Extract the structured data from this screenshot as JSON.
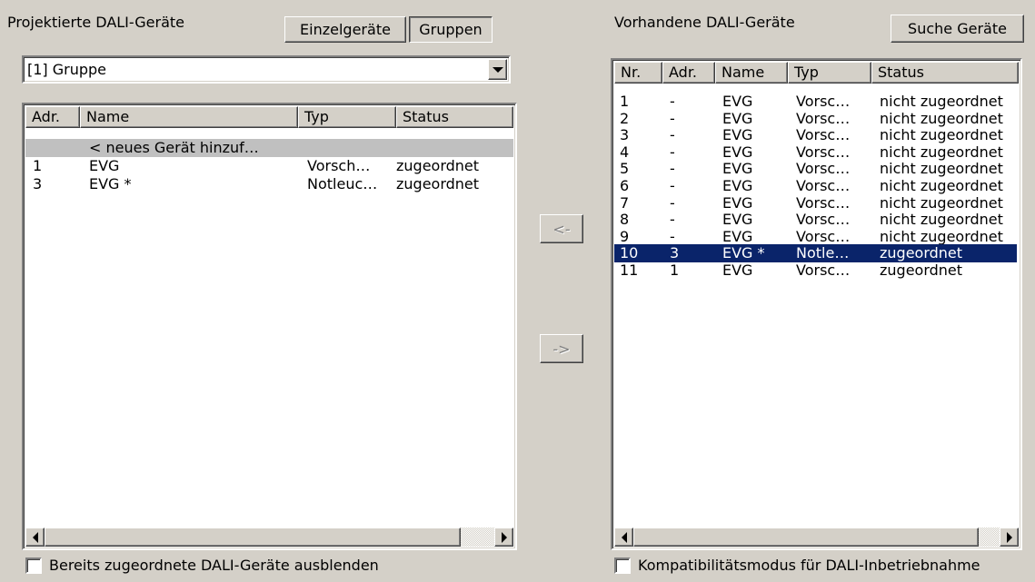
{
  "left": {
    "title": "Projektierte DALI-Geräte",
    "btn_single": "Einzelgeräte",
    "btn_groups": "Gruppen",
    "combo_value": "[1] Gruppe",
    "columns": [
      "Adr.",
      "Name",
      "Typ",
      "Status"
    ],
    "new_row": "< neues Gerät hinzuf…",
    "rows": [
      {
        "adr": "1",
        "name": "EVG",
        "typ": "Vorsch…",
        "status": "zugeordnet"
      },
      {
        "adr": "3",
        "name": "EVG *",
        "typ": "Notleuc…",
        "status": "zugeordnet"
      }
    ],
    "checkbox_label": "Bereits zugeordnete DALI-Geräte ausblenden"
  },
  "middle": {
    "assign_left": "<-",
    "assign_right": "->"
  },
  "right": {
    "title": "Vorhandene DALI-Geräte",
    "btn_search": "Suche Geräte",
    "columns": [
      "Nr.",
      "Adr.",
      "Name",
      "Typ",
      "Status"
    ],
    "rows": [
      {
        "nr": "1",
        "adr": "-",
        "name": "EVG",
        "typ": "Vorsc…",
        "status": "nicht zugeordnet"
      },
      {
        "nr": "2",
        "adr": "-",
        "name": "EVG",
        "typ": "Vorsc…",
        "status": "nicht zugeordnet"
      },
      {
        "nr": "3",
        "adr": "-",
        "name": "EVG",
        "typ": "Vorsc…",
        "status": "nicht zugeordnet"
      },
      {
        "nr": "4",
        "adr": "-",
        "name": "EVG",
        "typ": "Vorsc…",
        "status": "nicht zugeordnet"
      },
      {
        "nr": "5",
        "adr": "-",
        "name": "EVG",
        "typ": "Vorsc…",
        "status": "nicht zugeordnet"
      },
      {
        "nr": "6",
        "adr": "-",
        "name": "EVG",
        "typ": "Vorsc…",
        "status": "nicht zugeordnet"
      },
      {
        "nr": "7",
        "adr": "-",
        "name": "EVG",
        "typ": "Vorsc…",
        "status": "nicht zugeordnet"
      },
      {
        "nr": "8",
        "adr": "-",
        "name": "EVG",
        "typ": "Vorsc…",
        "status": "nicht zugeordnet"
      },
      {
        "nr": "9",
        "adr": "-",
        "name": "EVG",
        "typ": "Vorsc…",
        "status": "nicht zugeordnet"
      },
      {
        "nr": "10",
        "adr": "3",
        "name": "EVG *",
        "typ": "Notle…",
        "status": "zugeordnet",
        "selected": true
      },
      {
        "nr": "11",
        "adr": "1",
        "name": "EVG",
        "typ": "Vorsc…",
        "status": "zugeordnet"
      }
    ],
    "checkbox_label": "Kompatibilitätsmodus für DALI-Inbetriebnahme"
  },
  "colors": {
    "face": "#d4d0c8",
    "selection": "#0a246a",
    "new_row_bg": "#c0c0c0"
  }
}
